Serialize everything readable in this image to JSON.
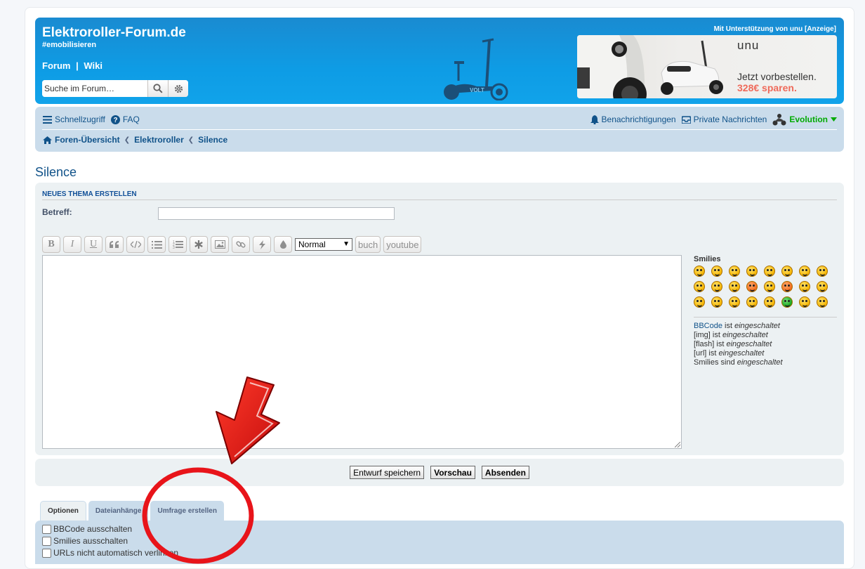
{
  "header": {
    "site_title": "Elektroroller-Forum.de",
    "tagline": "#emobilisieren",
    "link_forum": "Forum",
    "link_sep": "|",
    "link_wiki": "Wiki",
    "search_placeholder": "Suche im Forum…",
    "scooter_label": "VOLT",
    "ad_label": "Mit Unterstützung von unu [Anzeige]",
    "ad": {
      "brand": "unu",
      "line1": "Jetzt vorbestellen.",
      "line2": "328€ sparen."
    }
  },
  "navbar": {
    "quicklinks": "Schnellzugriff",
    "faq": "FAQ",
    "notifications": "Benachrichtigungen",
    "private_messages": "Private Nachrichten",
    "username": "Evolution",
    "breadcrumbs": [
      "Foren-Übersicht",
      "Elektroroller",
      "Silence"
    ]
  },
  "page_title": "Silence",
  "posting": {
    "heading": "NEUES THEMA ERSTELLEN",
    "subject_label": "Betreff:",
    "subject_value": "",
    "toolbar": {
      "bold": "B",
      "italic": "I",
      "underline": "U",
      "font_size_selected": "Normal",
      "custom1": "buch",
      "custom2": "youtube"
    },
    "smilies_title": "Smilies",
    "bbcode_status": {
      "bbcode_link": "BBCode",
      "bbcode_rest": "ist",
      "bbcode_state": "eingeschaltet",
      "img_label": "[img] ist",
      "img_state": "eingeschaltet",
      "flash_label": "[flash] ist",
      "flash_state": "eingeschaltet",
      "url_label": "[url] ist",
      "url_state": "eingeschaltet",
      "smilies_label": "Smilies sind",
      "smilies_state": "eingeschaltet"
    }
  },
  "submit": {
    "draft": "Entwurf speichern",
    "preview": "Vorschau",
    "send": "Absenden"
  },
  "tabs": [
    "Optionen",
    "Dateianhänge",
    "Umfrage erstellen"
  ],
  "options": [
    "BBCode ausschalten",
    "Smilies ausschalten",
    "URLs nicht automatisch verlinken"
  ],
  "colors": {
    "header_blue": "#1a8bd1",
    "nav_bg": "#cadceb",
    "panel_bg": "#ecf1f3",
    "link": "#105289",
    "username_green": "#00aa00",
    "annotation_red": "#e8141a"
  }
}
